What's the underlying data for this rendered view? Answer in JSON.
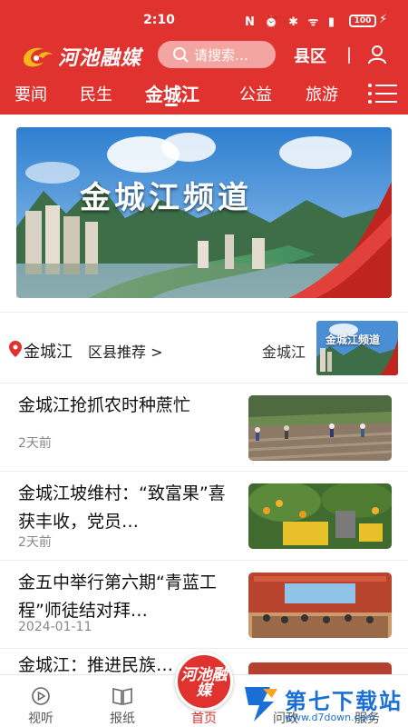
{
  "status_bar": {
    "time": "2:10",
    "battery": "100"
  },
  "header": {
    "logo_text": "河池融媒",
    "search_placeholder": "请搜索…",
    "county_button": "县区"
  },
  "tabs": [
    {
      "label": "要闻"
    },
    {
      "label": "民生"
    },
    {
      "label": "金城江"
    },
    {
      "label": "公益"
    },
    {
      "label": "旅游"
    }
  ],
  "banner": {
    "title": "金城江频道"
  },
  "county_row": {
    "name": "金城江",
    "recommend": "区县推荐 >",
    "right_label": "金城江",
    "thumb_title": "金城江频道"
  },
  "news": [
    {
      "title": "金城江抢抓农时种蔗忙",
      "time": "2天前"
    },
    {
      "title": "金城江坡维村：“致富果”喜获丰收，党员…",
      "time": "2天前"
    },
    {
      "title": "金五中举行第六期“青蓝工程”师徒结对拜…",
      "time": "2024-01-11"
    },
    {
      "title": "金城江：推进民族…",
      "time": ""
    }
  ],
  "bottom_nav": [
    {
      "label": "视听",
      "icon": "play-circle-icon"
    },
    {
      "label": "报纸",
      "icon": "book-icon"
    },
    {
      "label": "首页",
      "icon": "home-icon"
    },
    {
      "label": "问政",
      "icon": "message-icon"
    },
    {
      "label": "服务",
      "icon": "grid-icon"
    }
  ],
  "center_button": {
    "text": "河池融媒"
  },
  "watermark": {
    "text": "第七下载站",
    "url": "www.d7down.com"
  },
  "colors": {
    "brand_red": "#e0322e",
    "watermark_blue": "#1a6fd6"
  }
}
